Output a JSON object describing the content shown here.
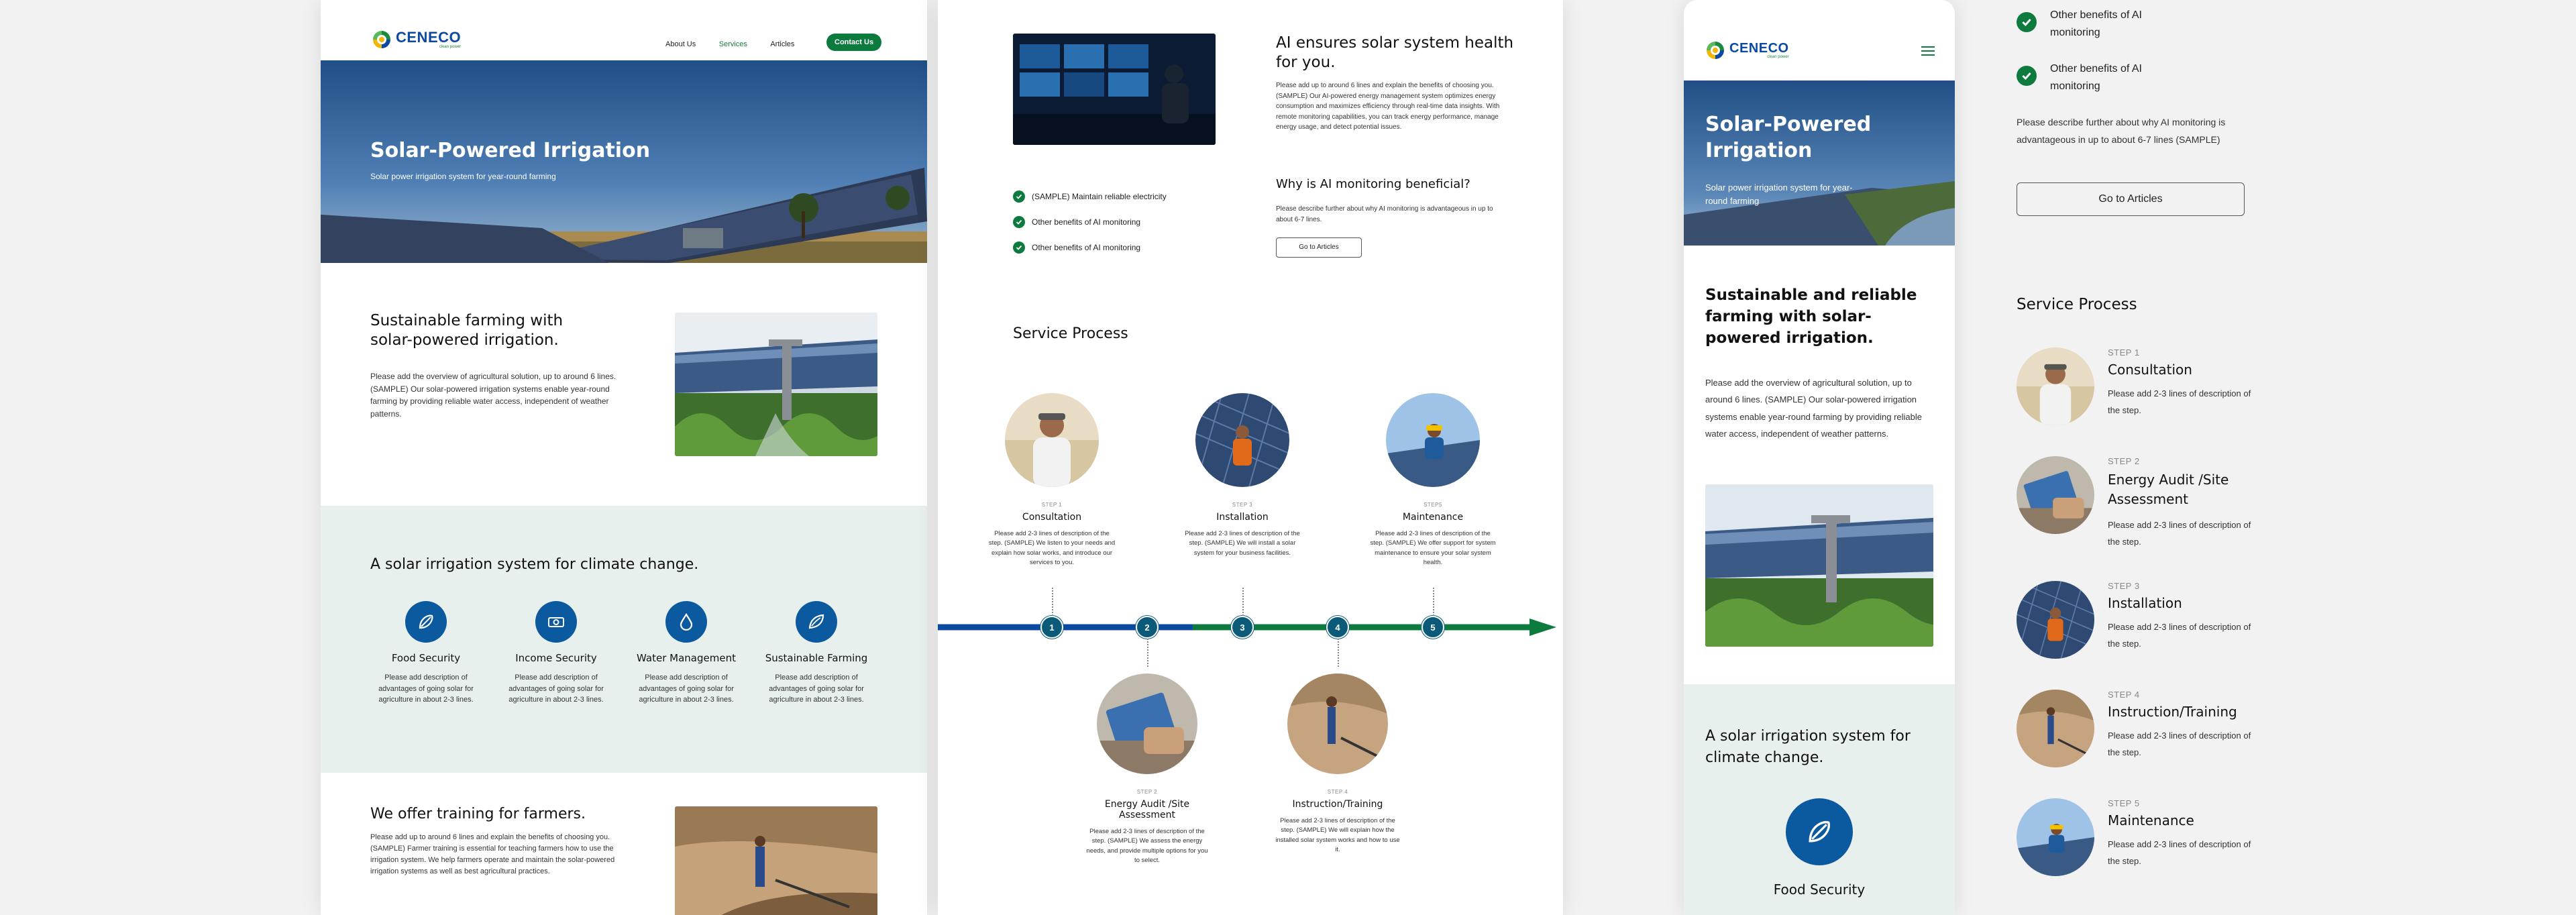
{
  "brand": {
    "name": "CENECO",
    "tagline": "clean power"
  },
  "nav": {
    "items": [
      "About Us",
      "Services",
      "Articles"
    ],
    "active": "Services",
    "cta": "Contact Us"
  },
  "hero": {
    "title": "Solar-Powered Irrigation",
    "subtitle": "Solar power irrigation system for year-round farming"
  },
  "intro": {
    "title_desktop": "Sustainable farming with solar-powered irrigation.",
    "title_mobile": "Sustainable and reliable farming with solar-powered irrigation.",
    "body": "Please add the overview of agricultural solution, up to around 6 lines. (SAMPLE) Our solar-powered irrigation systems enable year-round farming by providing reliable water access, independent of weather patterns.",
    "body_mobile": "Please add the overview of agricultural solution, up to around 6 lines. (SAMPLE) Our solar-powered irrigation systems enable year-round farming by providing reliable water access, independent of weather patterns."
  },
  "climate": {
    "title": "A solar irrigation system for climate change.",
    "benefits": [
      {
        "title": "Food Security",
        "desc": "Please add description of advantages of going solar for agriculture in about 2-3 lines.",
        "icon": "seed-icon"
      },
      {
        "title": "Income Security",
        "desc": "Please add description of advantages of going solar for agriculture in about 2-3 lines.",
        "icon": "money-icon"
      },
      {
        "title": "Water Management",
        "desc": "Please add description of advantages of going solar for agriculture in about 2-3 lines.",
        "icon": "water-drop-icon"
      },
      {
        "title": "Sustainable Farming",
        "desc": "Please add description of advantages of going solar for agriculture in about 2-3 lines.",
        "icon": "leaf-icon"
      }
    ]
  },
  "training": {
    "title": "We offer training for farmers.",
    "body": "Please add up to around 6 lines and explain the benefits of choosing you. (SAMPLE) Farmer training is essential for teaching farmers how to use the irrigation system. We help farmers operate and maintain the solar-powered irrigation systems as well as best agricultural practices."
  },
  "ai": {
    "title": "AI ensures solar system health for you.",
    "body": "Please add up to around 6 lines and explain the benefits of choosing you. (SAMPLE) Our AI-powered energy management system optimizes energy consumption and maximizes efficiency through real-time data insights. With remote monitoring capabilities, you can track energy performance, manage energy usage, and detect potential issues.",
    "checklist": [
      "(SAMPLE) Maintain reliable electricity",
      "Other benefits of AI monitoring",
      "Other benefits of AI monitoring"
    ],
    "why_title": "Why is AI monitoring beneficial?",
    "why_body": "Please describe further about why AI monitoring is advantageous in up to about 6-7 lines.",
    "why_body_mobile": "Please describe further about why AI monitoring is advantageous in up to about 6-7 lines (SAMPLE)",
    "button": "Go to Articles"
  },
  "process": {
    "title": "Service Process",
    "steps": [
      {
        "label": "STEP 1",
        "title": "Consultation",
        "desc": "Please add 2-3 lines of description of the step. (SAMPLE) We listen to your needs and explain how solar works, and introduce our services to you."
      },
      {
        "label": "STEP 2",
        "title": "Energy Audit /Site Assessment",
        "desc": "Please add 2-3 lines of description of the step. (SAMPLE) We assess the energy needs, and provide multiple options for you to select."
      },
      {
        "label": "STEP 3",
        "title": "Installation",
        "desc": "Please add 2-3 lines of description of the step. (SAMPLE) We will install a solar system for your business facilities."
      },
      {
        "label": "STEP 4",
        "title": "Instruction/Training",
        "desc": "Please add 2-3 lines of description of the step. (SAMPLE) We will explain how the installed solar system works and how to use it."
      },
      {
        "label": "STEP5",
        "title": "Maintenance",
        "desc": "Please add 2-3 lines of description of the step. (SAMPLE) We offer support for system maintenance to ensure your solar system health."
      }
    ],
    "nodes": [
      "1",
      "2",
      "3",
      "4",
      "5"
    ],
    "mobile_labels": [
      "STEP 1",
      "STEP 2",
      "STEP 3",
      "STEP 4",
      "STEP 5"
    ],
    "mobile_titles": [
      "Consultation",
      "Energy Audit /Site Assessment",
      "Installation",
      "Instruction/Training",
      "Maintenance"
    ],
    "mobile_desc": "Please add 2-3 lines of description of the step."
  },
  "colors": {
    "green": "#0d7a3e",
    "blue": "#0b5aa0",
    "navy": "#0b4aa2",
    "teal_bg": "#e8f0ee"
  }
}
